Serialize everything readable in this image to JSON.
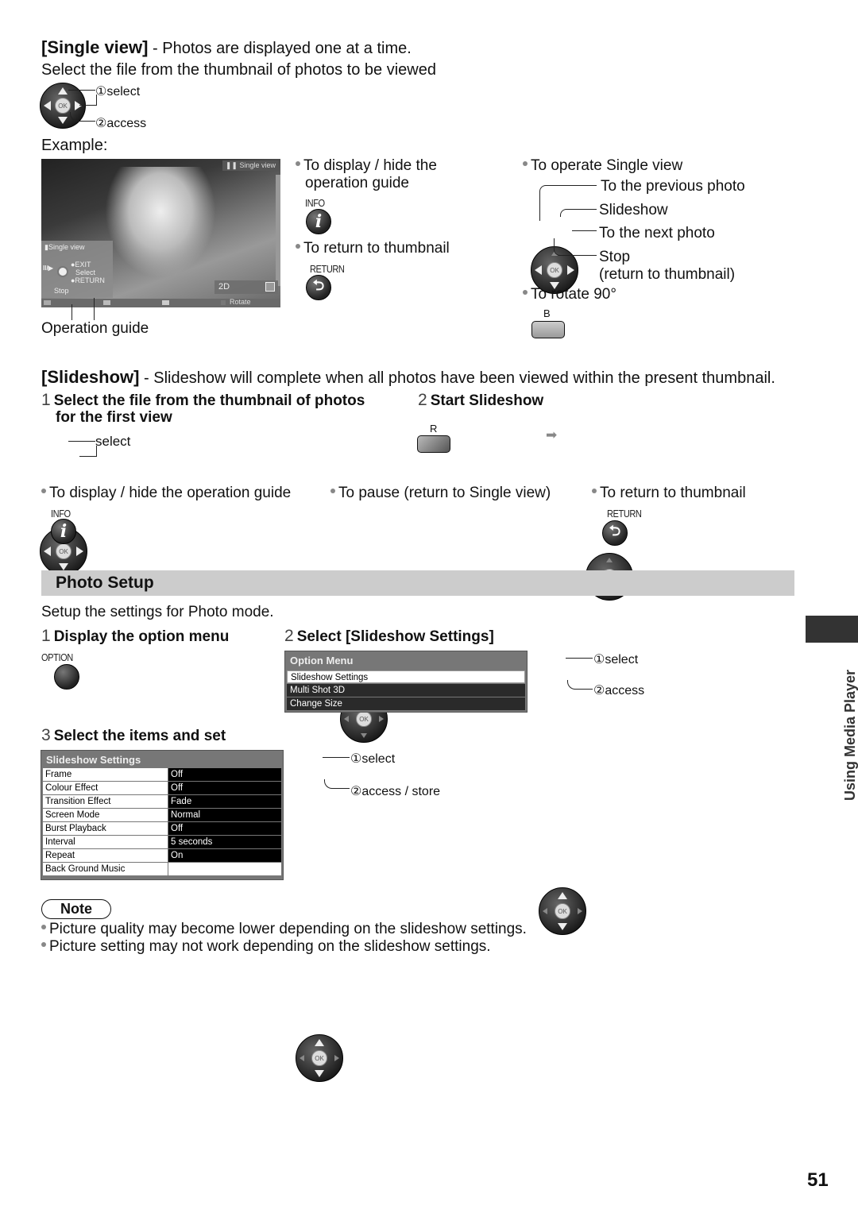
{
  "single_view": {
    "title": "[Single view]",
    "title_suffix": " - Photos are displayed one at a time.",
    "instruction": "Select the file from the thumbnail of photos to be viewed",
    "select_label": "①select",
    "access_label": "②access",
    "example_label": "Example:",
    "screen": {
      "top_badge": "Single view",
      "guide_title": "Single view",
      "guide_play": "II/▶",
      "guide_exit": "●EXIT",
      "guide_select": "Select",
      "guide_return": "●RETURN",
      "guide_stop": "Stop",
      "mode_badge": "2D",
      "rotate_label": "Rotate"
    },
    "operation_guide_caption": "Operation guide",
    "display_hide": "To display / hide the operation guide",
    "display_hide_line1": "To display / hide the",
    "display_hide_line2": "operation guide",
    "info_key": "INFO",
    "info_icon": "i",
    "return_to_thumbnail": "To return to thumbnail",
    "return_key": "RETURN",
    "operate_title": "To operate Single view",
    "prev_photo": "To the previous photo",
    "slideshow": "Slideshow",
    "next_photo": "To the next photo",
    "stop": "Stop",
    "stop_sub": "(return to thumbnail)",
    "rotate": "To rotate 90°",
    "rotate_key": "B"
  },
  "slideshow": {
    "title": "[Slideshow]",
    "title_suffix": " - Slideshow will complete when all photos have been viewed within the present thumbnail.",
    "step1_num": "1",
    "step1_line1": "Select the file from the thumbnail of photos",
    "step1_line2": "for the first view",
    "step1_select": "select",
    "step2_num": "2",
    "step2_label": "Start Slideshow",
    "step2_key": "R",
    "arrow": "➡",
    "tip_display_hide": "To display / hide the operation guide",
    "tip_info_key": "INFO",
    "tip_pause": "To pause (return to Single view)",
    "tip_return": "To return to thumbnail",
    "tip_return_key": "RETURN"
  },
  "photo_setup": {
    "title": "Photo Setup",
    "intro": "Setup the settings for Photo mode.",
    "step1_num": "1",
    "step1_label": "Display the option menu",
    "option_key": "OPTION",
    "step2_num": "2",
    "step2_label": "Select [Slideshow Settings]",
    "option_menu": {
      "title": "Option Menu",
      "items": [
        {
          "label": "Slideshow Settings",
          "selected": true
        },
        {
          "label": "Multi Shot 3D",
          "selected": false
        },
        {
          "label": "Change Size",
          "selected": false
        }
      ]
    },
    "step2_select": "①select",
    "step2_access": "②access",
    "step3_num": "3",
    "step3_label": "Select the items and set",
    "settings_menu": {
      "title": "Slideshow Settings",
      "rows": [
        {
          "key": "Frame",
          "value": "Off"
        },
        {
          "key": "Colour Effect",
          "value": "Off"
        },
        {
          "key": "Transition Effect",
          "value": "Fade"
        },
        {
          "key": "Screen Mode",
          "value": "Normal"
        },
        {
          "key": "Burst Playback",
          "value": "Off"
        },
        {
          "key": "Interval",
          "value": "5 seconds"
        },
        {
          "key": "Repeat",
          "value": "On"
        },
        {
          "key": "Back Ground Music",
          "value": ""
        }
      ]
    },
    "step3_select": "①select",
    "step3_access": "②access / store"
  },
  "note": {
    "label": "Note",
    "items": [
      "Picture quality may become lower depending on the slideshow settings.",
      "Picture setting may not work depending on the slideshow settings."
    ]
  },
  "side_tab": "Using Media Player",
  "page_number": "51"
}
